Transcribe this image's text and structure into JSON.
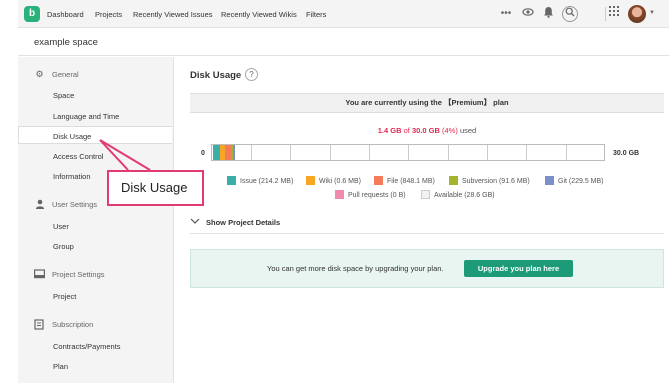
{
  "topnav": {
    "logo_letter": "b",
    "items": [
      "Dashboard",
      "Projects",
      "Recently Viewed Issues",
      "Recently Viewed Wikis",
      "Filters"
    ],
    "icons": [
      "more-icon",
      "eye-icon",
      "bell-icon",
      "search-icon",
      "apps-grid-icon",
      "user-avatar"
    ]
  },
  "space": {
    "name": "example space"
  },
  "sidebar": {
    "sections": [
      {
        "label": "General",
        "icon": "gear-icon",
        "items": [
          "Space",
          "Language and Time",
          "Disk Usage",
          "Access Control",
          "Information"
        ]
      },
      {
        "label": "User Settings",
        "icon": "user-icon",
        "items": [
          "User",
          "Group"
        ]
      },
      {
        "label": "Project Settings",
        "icon": "folder-icon",
        "items": [
          "Project"
        ]
      },
      {
        "label": "Subscription",
        "icon": "subscription-icon",
        "items": [
          "Contracts/Payments",
          "Plan"
        ]
      }
    ],
    "active_item": "Disk Usage"
  },
  "main": {
    "title": "Disk Usage",
    "help": "?",
    "plan_text": "You are currently using the 【Premium】 plan",
    "usage": {
      "used": "1.4 GB",
      "of": "of",
      "total": "30.0 GB",
      "pct": "(4%)",
      "suffix": "used"
    },
    "bar_min": "0",
    "bar_max": "30.0 GB",
    "details_label": "Show Project Details",
    "upgrade_text": "You can get more disk space by upgrading your plan.",
    "upgrade_button": "Upgrade you plan here"
  },
  "legend": [
    {
      "label": "Issue (214.2 MB)",
      "color": "#3aafa9"
    },
    {
      "label": "Wiki (0.6 MB)",
      "color": "#f6a623"
    },
    {
      "label": "File (848.1 MB)",
      "color": "#f47c5a"
    },
    {
      "label": "Subversion (91.6 MB)",
      "color": "#a4b42c"
    },
    {
      "label": "Git (229.5 MB)",
      "color": "#7b8fc9"
    },
    {
      "label": "Pull requests (0 B)",
      "color": "#f08aae"
    },
    {
      "label": "Available (28.6 GB)",
      "color": "#f2f2f2"
    }
  ],
  "callout": {
    "text": "Disk Usage",
    "color": "#e23a75"
  }
}
